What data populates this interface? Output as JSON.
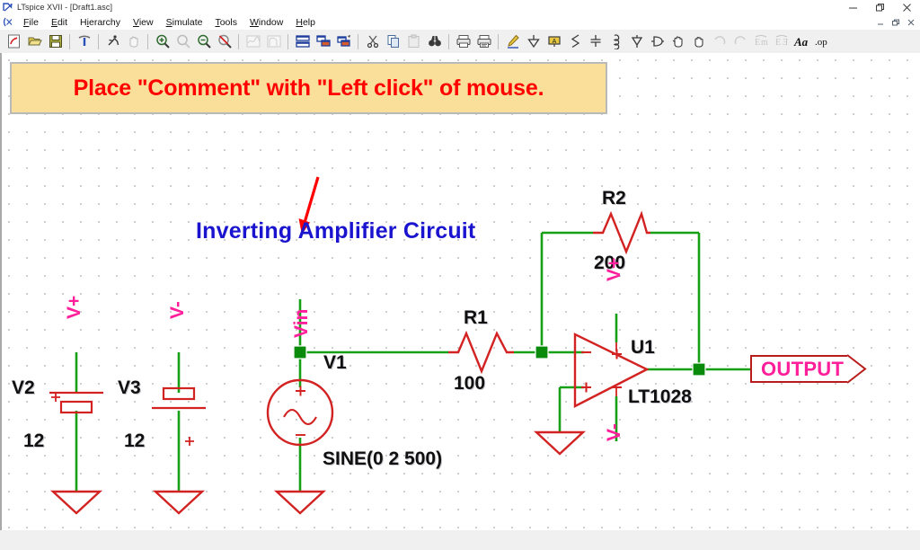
{
  "window": {
    "title": "LTspice XVII - [Draft1.asc]",
    "app_icon": "ltspice-logo-icon",
    "controls": [
      {
        "name": "minimize-button",
        "glyph": "minimize-icon"
      },
      {
        "name": "restore-button",
        "glyph": "restore-icon"
      },
      {
        "name": "close-button",
        "glyph": "close-icon"
      }
    ],
    "mdi_controls": [
      {
        "name": "mdi-minimize-button",
        "glyph": "minimize-icon"
      },
      {
        "name": "mdi-restore-button",
        "glyph": "restore-icon"
      },
      {
        "name": "mdi-close-button",
        "glyph": "close-icon"
      }
    ]
  },
  "menu": {
    "items": [
      {
        "label": "File",
        "mnemonic": "F"
      },
      {
        "label": "Edit",
        "mnemonic": "E"
      },
      {
        "label": "Hierarchy",
        "mnemonic": "i"
      },
      {
        "label": "View",
        "mnemonic": "V"
      },
      {
        "label": "Simulate",
        "mnemonic": "S"
      },
      {
        "label": "Tools",
        "mnemonic": "T"
      },
      {
        "label": "Window",
        "mnemonic": "W"
      },
      {
        "label": "Help",
        "mnemonic": "H"
      }
    ]
  },
  "toolbar": {
    "buttons": [
      {
        "name": "new-schematic-icon",
        "tip": "New Schematic",
        "enabled": true
      },
      {
        "name": "open-folder-icon",
        "tip": "Open",
        "enabled": true
      },
      {
        "name": "save-floppy-icon",
        "tip": "Save",
        "enabled": true
      },
      {
        "name": "hammer-build-icon",
        "tip": "Run",
        "enabled": true
      },
      {
        "name": "runner-halt-icon",
        "tip": "Halt",
        "enabled": true
      },
      {
        "name": "hand-pan-icon",
        "tip": "Pan",
        "enabled": false
      },
      {
        "name": "zoom-in-icon",
        "tip": "Zoom In",
        "enabled": true
      },
      {
        "name": "zoom-area-icon",
        "tip": "Zoom Area",
        "enabled": false
      },
      {
        "name": "zoom-out-icon",
        "tip": "Zoom Out",
        "enabled": true
      },
      {
        "name": "zoom-back-icon",
        "tip": "Zoom Back",
        "enabled": true
      },
      {
        "name": "waveform-icon",
        "tip": "Waveforms",
        "enabled": false
      },
      {
        "name": "fft-icon",
        "tip": "FFT",
        "enabled": false
      },
      {
        "name": "tile-horizontal-icon",
        "tip": "Tile Horizontally",
        "enabled": true
      },
      {
        "name": "tile-vertical-icon",
        "tip": "Tile Vertically",
        "enabled": true
      },
      {
        "name": "cascade-icon",
        "tip": "Cascade",
        "enabled": true
      },
      {
        "name": "cut-scissors-icon",
        "tip": "Cut",
        "enabled": true
      },
      {
        "name": "copy-icon",
        "tip": "Copy",
        "enabled": true
      },
      {
        "name": "paste-icon",
        "tip": "Paste",
        "enabled": false
      },
      {
        "name": "find-binoculars-icon",
        "tip": "Find",
        "enabled": true
      },
      {
        "name": "print-icon",
        "tip": "Print",
        "enabled": true
      },
      {
        "name": "print-preview-icon",
        "tip": "Print Preview",
        "enabled": true
      },
      {
        "name": "draw-wire-pencil-icon",
        "tip": "Draw Wire",
        "enabled": true
      },
      {
        "name": "ground-icon",
        "tip": "Place GND",
        "enabled": true
      },
      {
        "name": "net-label-icon",
        "tip": "Label Net",
        "enabled": true
      },
      {
        "name": "resistor-icon",
        "tip": "Resistor",
        "enabled": true
      },
      {
        "name": "capacitor-icon",
        "tip": "Capacitor",
        "enabled": true
      },
      {
        "name": "inductor-icon",
        "tip": "Inductor",
        "enabled": true
      },
      {
        "name": "diode-icon",
        "tip": "Diode",
        "enabled": true
      },
      {
        "name": "component-icon",
        "tip": "Component",
        "enabled": true
      },
      {
        "name": "move-hand-icon",
        "tip": "Move",
        "enabled": true
      },
      {
        "name": "drag-hand-icon",
        "tip": "Drag",
        "enabled": true
      },
      {
        "name": "undo-icon",
        "tip": "Undo",
        "enabled": false
      },
      {
        "name": "redo-icon",
        "tip": "Redo",
        "enabled": false
      },
      {
        "name": "mirror-icon",
        "tip": "Mirror",
        "enabled": false
      },
      {
        "name": "rotate-icon",
        "tip": "Rotate",
        "enabled": false
      },
      {
        "name": "text-aa-icon",
        "tip": "Place Text",
        "enabled": true
      },
      {
        "name": "spice-directive-icon",
        "tip": "SPICE Directive .op",
        "enabled": true
      }
    ]
  },
  "schematic": {
    "comment": {
      "text": "Place \"Comment\" with \"Left click\" of mouse.",
      "fill": "#fadf9a",
      "border": "#b9b9b9",
      "text_color": "#ff0000"
    },
    "title": {
      "text": "Inverting Amplifier Circuit",
      "color": "#1a14cf"
    },
    "arrow": {
      "color": "#ff0000"
    },
    "components": [
      {
        "ref": "V2",
        "value": "12",
        "kind": "battery",
        "polarity": "+"
      },
      {
        "ref": "V3",
        "value": "12",
        "kind": "battery",
        "polarity": "+"
      },
      {
        "ref": "V1",
        "value": "SINE(0 2 500)",
        "kind": "sine-source"
      },
      {
        "ref": "R1",
        "value": "100",
        "kind": "resistor"
      },
      {
        "ref": "R2",
        "value": "200",
        "kind": "resistor"
      },
      {
        "ref": "U1",
        "value": "LT1028",
        "kind": "opamp"
      }
    ],
    "net_labels": [
      {
        "text": "V+",
        "rotated": false
      },
      {
        "text": "V-",
        "rotated": false
      },
      {
        "text": "Vin",
        "rotated": true
      },
      {
        "text": "V+",
        "rotated": false
      },
      {
        "text": "V-",
        "rotated": false
      }
    ],
    "output_flag": {
      "text": "OUTPUT",
      "text_color": "#ff1f9a",
      "border_color": "#b81c1c"
    },
    "opamp_pins": {
      "inverting": "−",
      "noninverting": "+",
      "vplus": "+",
      "vminus": "−"
    },
    "colors": {
      "wire": "#15a015",
      "symbol": "#d32222",
      "junction": "#0a8a0a",
      "label_black": "#101010",
      "label_net": "#ff1f9a"
    }
  },
  "statusbar": {
    "text": ""
  }
}
